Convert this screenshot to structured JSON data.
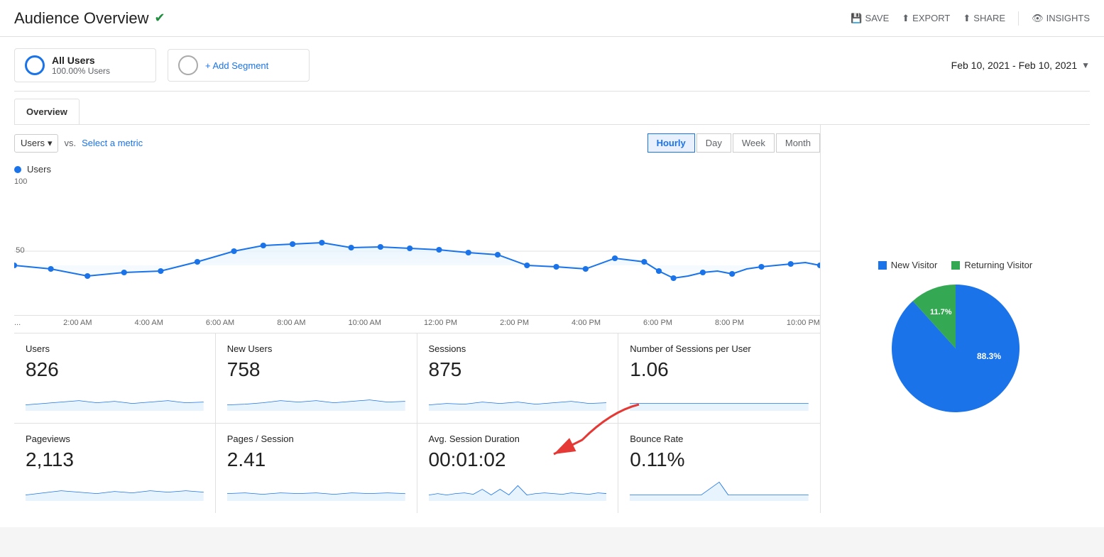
{
  "header": {
    "title": "Audience Overview",
    "verified_icon": "✔",
    "actions": [
      {
        "label": "SAVE",
        "icon": "💾"
      },
      {
        "label": "EXPORT",
        "icon": "⬆"
      },
      {
        "label": "SHARE",
        "icon": "⬆"
      },
      {
        "label": "INSIGHTS",
        "icon": "👁"
      }
    ]
  },
  "segment": {
    "all_users_label": "All Users",
    "all_users_pct": "100.00% Users",
    "add_segment_label": "+ Add Segment"
  },
  "date_range": {
    "label": "Feb 10, 2021 - Feb 10, 2021"
  },
  "tab": {
    "label": "Overview"
  },
  "chart_controls": {
    "metric_label": "Users",
    "vs_label": "vs.",
    "select_metric_label": "Select a metric",
    "time_buttons": [
      "Hourly",
      "Day",
      "Week",
      "Month"
    ],
    "active_time": "Hourly"
  },
  "chart": {
    "legend_label": "Users",
    "y_label": "100",
    "y_mid": "50",
    "x_labels": [
      "...",
      "2:00 AM",
      "4:00 AM",
      "6:00 AM",
      "8:00 AM",
      "10:00 AM",
      "12:00 PM",
      "2:00 PM",
      "4:00 PM",
      "6:00 PM",
      "8:00 PM",
      "10:00 PM"
    ]
  },
  "metrics": [
    {
      "label": "Users",
      "value": "826",
      "row": 1
    },
    {
      "label": "New Users",
      "value": "758",
      "row": 1
    },
    {
      "label": "Sessions",
      "value": "875",
      "row": 1
    },
    {
      "label": "Number of Sessions per User",
      "value": "1.06",
      "row": 1
    },
    {
      "label": "Pageviews",
      "value": "2,113",
      "row": 2
    },
    {
      "label": "Pages / Session",
      "value": "2.41",
      "row": 2
    },
    {
      "label": "Avg. Session Duration",
      "value": "00:01:02",
      "row": 2
    },
    {
      "label": "Bounce Rate",
      "value": "0.11%",
      "row": 2
    }
  ],
  "pie_chart": {
    "new_visitor_label": "New Visitor",
    "new_visitor_pct": "88.3%",
    "new_visitor_color": "#1a73e8",
    "returning_visitor_label": "Returning Visitor",
    "returning_visitor_pct": "11.7%",
    "returning_visitor_color": "#34a853"
  },
  "colors": {
    "accent_blue": "#1a73e8",
    "accent_green": "#34a853",
    "chart_line": "#1a73e8",
    "chart_fill": "#e8f4fd"
  }
}
